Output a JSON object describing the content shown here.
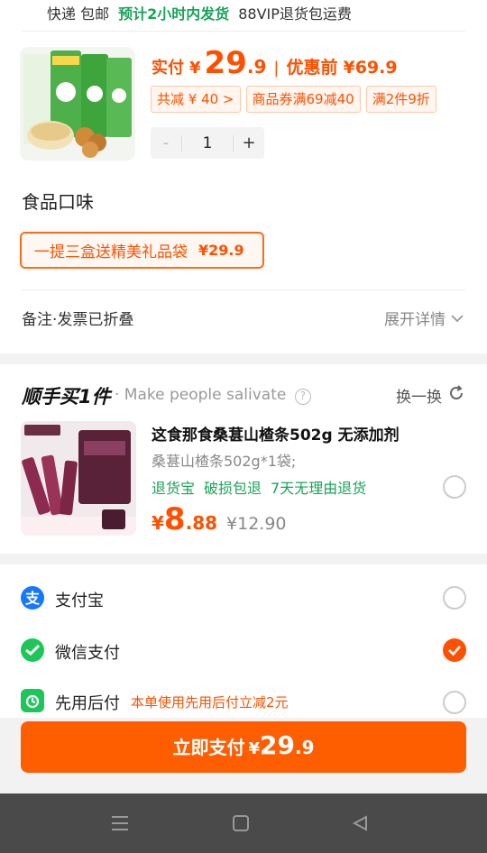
{
  "shipping": {
    "method": "快递 包邮",
    "eta": "预计2小时内发货",
    "vip": "88VIP退货包运费"
  },
  "product": {
    "pay_label": "实付",
    "currency": "¥",
    "price_int": "29",
    "price_dec": ".9",
    "before_label": "优惠前",
    "before_price": "¥69.9",
    "tags": [
      "共减 ¥ 40 >",
      "商品券满69减40",
      "满2件9折"
    ],
    "quantity": "1",
    "minus": "-",
    "plus": "+"
  },
  "flavor": {
    "title": "食品口味",
    "option": "一提三盒送精美礼品袋",
    "option_price": "¥29.9"
  },
  "remark": {
    "label": "备注·发票已折叠",
    "expand": "展开详情"
  },
  "addon": {
    "title": "顺手买1件",
    "subtitle": "· Make people salivate",
    "swap": "换一换",
    "name": "这食那食桑葚山楂条502g 无添加剂",
    "spec": "桑葚山楂条502g*1袋;",
    "services": [
      "退货宝",
      "破损包退",
      "7天无理由退货"
    ],
    "currency": "¥",
    "price_int": "8",
    "price_dec": ".88",
    "orig_price": "¥12.90"
  },
  "payment": {
    "methods": [
      {
        "label": "支付宝",
        "selected": false
      },
      {
        "label": "微信支付",
        "selected": true
      },
      {
        "label": "先用后付",
        "note": "本单使用先用后付立减2元",
        "selected": false
      }
    ]
  },
  "submit": {
    "label": "立即支付",
    "currency": "¥",
    "price_int": "29",
    "price_dec": ".9"
  },
  "colors": {
    "accent": "#ff5000",
    "button": "#ff5e00",
    "green": "#1aa35a",
    "wechat": "#1ec65a",
    "alipay": "#1677ff"
  }
}
